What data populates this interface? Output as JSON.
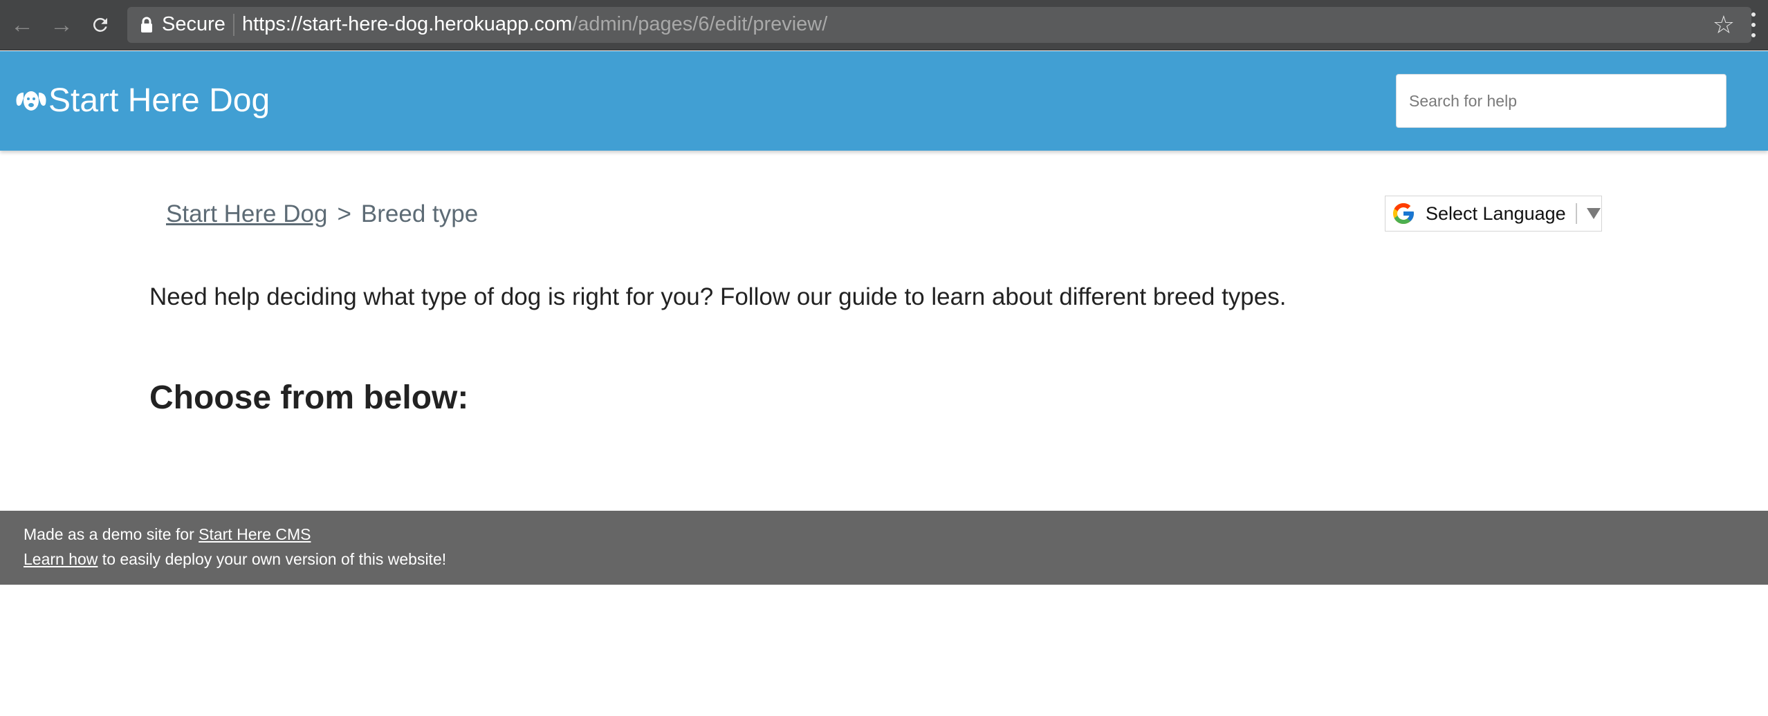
{
  "browser": {
    "secure_label": "Secure",
    "url_scheme": "https://",
    "url_host": "start-here-dog.herokuapp.com",
    "url_path": "/admin/pages/6/edit/preview/"
  },
  "header": {
    "brand": "Start Here Dog",
    "search_placeholder": "Search for help",
    "background_color": "#419fd3"
  },
  "breadcrumb": {
    "home_label": "Start Here Dog",
    "separator": ">",
    "current_label": "Breed type"
  },
  "translate": {
    "label": "Select Language"
  },
  "content": {
    "intro": "Need help deciding what type of dog is right for you? Follow our guide to learn about different breed types.",
    "heading": "Choose from below:"
  },
  "footer": {
    "line1_prefix": "Made as a demo site for ",
    "line1_link": "Start Here CMS",
    "line2_link": "Learn how",
    "line2_suffix": " to easily deploy your own version of this website!",
    "background_color": "#666666"
  },
  "icons": {
    "back": "back-arrow-icon",
    "forward": "forward-arrow-icon",
    "reload": "reload-icon",
    "lock": "lock-icon",
    "bookmark": "star-icon",
    "menu": "kebab-menu-icon",
    "brand": "dog-face-icon",
    "translate": "google-g-icon",
    "dropdown": "caret-down-icon"
  }
}
